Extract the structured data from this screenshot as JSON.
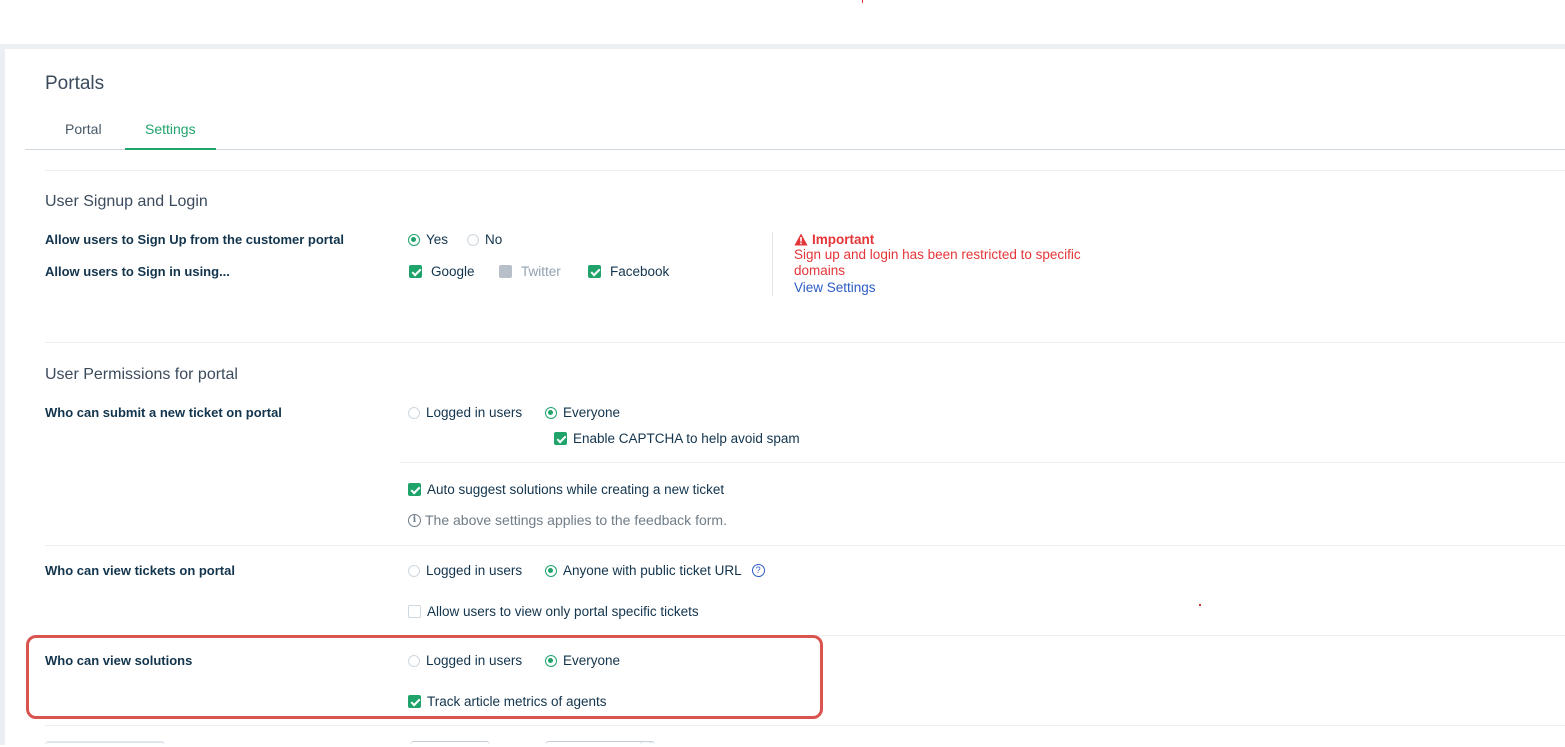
{
  "page": {
    "title": "Portals",
    "tabs": [
      {
        "label": "Portal",
        "active": false
      },
      {
        "label": "Settings",
        "active": true
      }
    ]
  },
  "signup_section": {
    "title": "User Signup and Login",
    "signup_label": "Allow users to Sign Up from the customer portal",
    "signup_options": [
      {
        "label": "Yes",
        "selected": true
      },
      {
        "label": "No",
        "selected": false
      }
    ],
    "signin_label": "Allow users to Sign in using...",
    "signin_options": [
      {
        "label": "Google",
        "checked": true
      },
      {
        "label": "Twitter",
        "checked": false,
        "disabled": true
      },
      {
        "label": "Facebook",
        "checked": true
      }
    ],
    "important": {
      "title": "Important",
      "message": "Sign up and login has been restricted to specific domains",
      "link": "View Settings"
    }
  },
  "permissions_section": {
    "title": "User Permissions for portal",
    "submit_ticket": {
      "label": "Who can submit a new ticket on portal",
      "options": [
        {
          "label": "Logged in users",
          "selected": false
        },
        {
          "label": "Everyone",
          "selected": true
        }
      ],
      "captcha": {
        "label": "Enable CAPTCHA to help avoid spam",
        "checked": true
      }
    },
    "auto_suggest": {
      "label": "Auto suggest solutions while creating a new ticket",
      "checked": true
    },
    "feedback_note": "The above settings applies to the feedback form.",
    "view_tickets": {
      "label": "Who can view tickets on portal",
      "options": [
        {
          "label": "Logged in users",
          "selected": false
        },
        {
          "label": "Anyone with public ticket URL",
          "selected": true
        }
      ],
      "portal_specific": {
        "label": "Allow users to view only portal specific tickets",
        "checked": false
      }
    },
    "view_solutions": {
      "label": "Who can view solutions",
      "options": [
        {
          "label": "Logged in users",
          "selected": false
        },
        {
          "label": "Everyone",
          "selected": true
        }
      ],
      "track_metrics": {
        "label": "Track article metrics of agents",
        "checked": true
      }
    }
  },
  "colors": {
    "accent": "#1fa36b",
    "warning": "#e43538",
    "link": "#2c5cc5",
    "highlight_border": "#d9534f"
  }
}
